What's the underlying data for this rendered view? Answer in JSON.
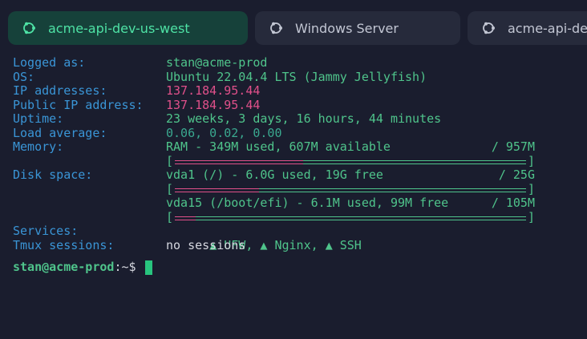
{
  "tabs": [
    {
      "label": "acme-api-dev-us-west",
      "icon": "ubuntu-icon",
      "active": true
    },
    {
      "label": "Windows Server",
      "icon": "ubuntu-icon",
      "active": false
    },
    {
      "label": "acme-api-dev",
      "icon": "ubuntu-icon",
      "active": false
    }
  ],
  "info": {
    "logged_label": "Logged as:",
    "logged_value": "stan@acme-prod",
    "os_label": "OS:",
    "os_value": "Ubuntu 22.04.4 LTS (Jammy Jellyfish)",
    "ip_label": "IP addresses:",
    "ip_value": "137.184.95.44",
    "public_ip_label": "Public IP address:",
    "public_ip_value": "137.184.95.44",
    "uptime_label": "Uptime:",
    "uptime_value": "23 weeks, 3 days, 16 hours, 44 minutes",
    "load_label": "Load average:",
    "load_value": "0.06, 0.02, 0.00",
    "memory_label": "Memory:",
    "memory_text": "RAM - 349M used, 607M available",
    "memory_total": "/ 957M",
    "memory_used_fraction": 0.365,
    "disk_label": "Disk space:",
    "disk1_text": "vda1 (/) - 6.0G used, 19G free",
    "disk1_total": "/ 25G",
    "disk1_used_fraction": 0.24,
    "disk2_text": "vda15 (/boot/efi) - 6.1M used, 99M free",
    "disk2_total": "/ 105M",
    "disk2_used_fraction": 0.06,
    "services_label": "Services:",
    "services": [
      "UFW",
      "Nginx",
      "SSH"
    ],
    "services_status_glyph": "▲",
    "tmux_label": "Tmux sessions:",
    "tmux_value": "no sessions"
  },
  "prompt": {
    "userhost": "stan@acme-prod",
    "path": ":~$"
  },
  "colors": {
    "accent": "#4fc48b",
    "label": "#3a95d6",
    "highlight": "#e0508a",
    "background": "#1a1d2e"
  }
}
